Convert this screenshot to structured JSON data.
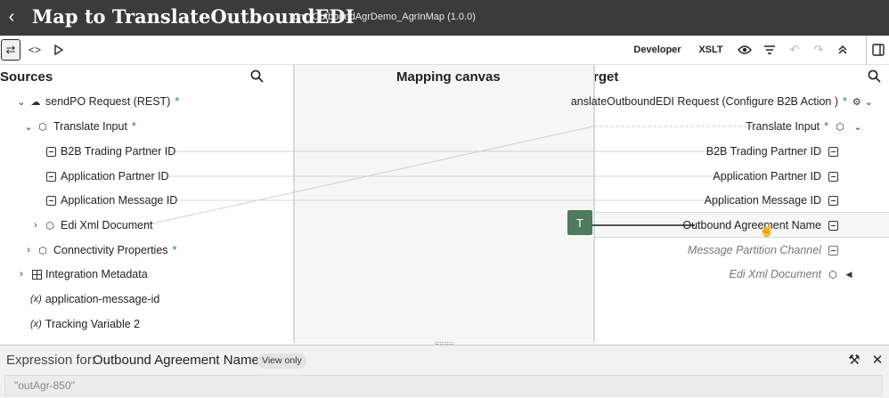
{
  "header": {
    "back_glyph": "‹",
    "title": "Map to TranslateOutboundEDI",
    "subtitle": "tpm_OutboundAgrDemo_AgrInMap (1.0.0)"
  },
  "toolbar": {
    "developer_label": "Developer",
    "xslt_label": "XSLT"
  },
  "sources": {
    "title": "Sources",
    "items": [
      {
        "label": "sendPO Request (REST)",
        "required": "*"
      },
      {
        "label": "Translate Input",
        "required": "*"
      },
      {
        "label": "B2B Trading Partner ID"
      },
      {
        "label": "Application Partner ID"
      },
      {
        "label": "Application Message ID"
      },
      {
        "label": "Edi Xml Document"
      },
      {
        "label": "Connectivity Properties",
        "required": "*"
      },
      {
        "label": "Integration Metadata"
      },
      {
        "label": "application-message-id",
        "prefix": "(x)"
      },
      {
        "label": "Tracking Variable 2",
        "prefix": "(x)"
      }
    ]
  },
  "canvas": {
    "title": "Mapping canvas",
    "function_glyph": "T"
  },
  "target": {
    "title": "rget",
    "items": [
      {
        "label": "anslateOutboundEDI Request (Configure B2B Action )",
        "required": "*"
      },
      {
        "label": "Translate Input",
        "required": "*"
      },
      {
        "label": "B2B Trading Partner ID"
      },
      {
        "label": "Application Partner ID"
      },
      {
        "label": "Application Message ID"
      },
      {
        "label": "Outbound Agreement Name"
      },
      {
        "label": "Message Partition Channel"
      },
      {
        "label": "Edi Xml Document"
      }
    ]
  },
  "expression": {
    "label": "Expression for:",
    "name": "Outbound Agreement Name",
    "badge": "View only",
    "value": "\"outAgr-850\""
  },
  "colors": {
    "header_bg": "#3b3b3b",
    "required_star": "#2a6fb6",
    "function_node": "#4f7b5d",
    "link_line": "#c9c9c9"
  },
  "icons": [
    "back-icon",
    "swap-icon",
    "code-icon",
    "play-icon",
    "eye-icon",
    "filter-icon",
    "undo-icon",
    "redo-icon",
    "collapse-icon",
    "panel-toggle-icon",
    "search-icon",
    "cloud-icon",
    "cube-icon",
    "element-icon",
    "grid-icon",
    "variable-icon",
    "tools-icon",
    "close-icon",
    "cursor-hand-icon"
  ]
}
